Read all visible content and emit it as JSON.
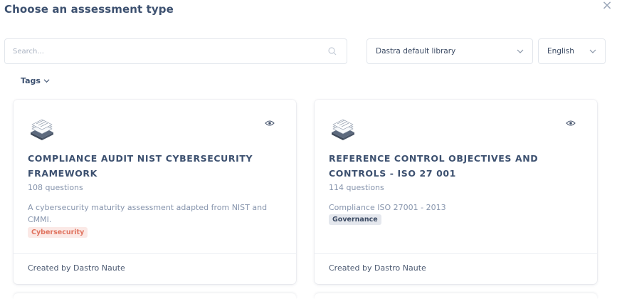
{
  "dialog": {
    "title": "Choose an assessment type",
    "close_icon": "close-icon"
  },
  "filters": {
    "search_placeholder": "Search...",
    "library": "Dastra default library",
    "language": "English",
    "tags_label": "Tags"
  },
  "cards": [
    {
      "title": "COMPLIANCE AUDIT NIST CYBERSECURITY FRAMEWORK",
      "questions": "108 questions",
      "description": "A cybersecurity maturity assessment adapted from NIST and CMMI.",
      "tag": "Cybersecurity",
      "tag_color": "#e0735f",
      "author": "Created by Dastro Naute"
    },
    {
      "title": "REFERENCE CONTROL OBJECTIVES AND CONTROLS - ISO 27 001",
      "questions": "114 questions",
      "description": "Compliance ISO 27001 - 2013",
      "tag": "Governance",
      "tag_color": "#3b4a63",
      "author": "Created by Dastro Naute"
    }
  ]
}
